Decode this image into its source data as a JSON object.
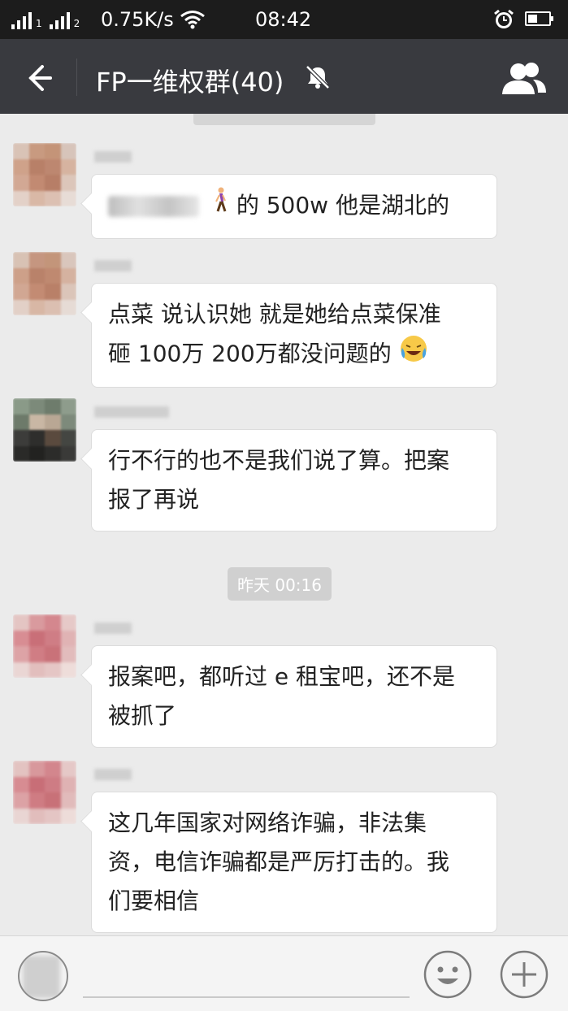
{
  "status_bar": {
    "sim1": "1",
    "sim2": "2",
    "net_speed": "0.75K/s",
    "time": "08:42",
    "battery_level": 0.45
  },
  "header": {
    "title": "FP一维权群(40)",
    "back_icon": "arrow-left-icon",
    "mute_icon": "bell-off-icon",
    "group_icon": "group-members-icon"
  },
  "messages": [
    {
      "text": "的 500w  他是湖北的",
      "has_redacted_prefix": true,
      "emoji": "person-walking"
    },
    {
      "line1": "点菜 说认识她 就是她给点菜保准",
      "line2": "砸 100万 200万都没问题的",
      "emoji": "crying-laughing"
    },
    {
      "line1": "行不行的也不是我们说了算。把案",
      "line2": "报了再说"
    },
    {
      "line1": "报案吧，都听过 e 租宝吧，还不是",
      "line2": "被抓了"
    },
    {
      "line1": "这几年国家对网络诈骗，非法集",
      "line2": "资，电信诈骗都是严厉打击的。我",
      "line3": "们要相信"
    }
  ],
  "timestamps": {
    "divider": "昨天 00:16"
  },
  "input_bar": {
    "voice_icon": "voice-toggle-icon",
    "emoji_icon": "emoji-icon",
    "plus_icon": "plus-icon"
  },
  "colors": {
    "status_bar": "#1c1c1c",
    "nav_bar": "#393a3f",
    "background": "#ebebeb",
    "bubble": "#ffffff"
  }
}
